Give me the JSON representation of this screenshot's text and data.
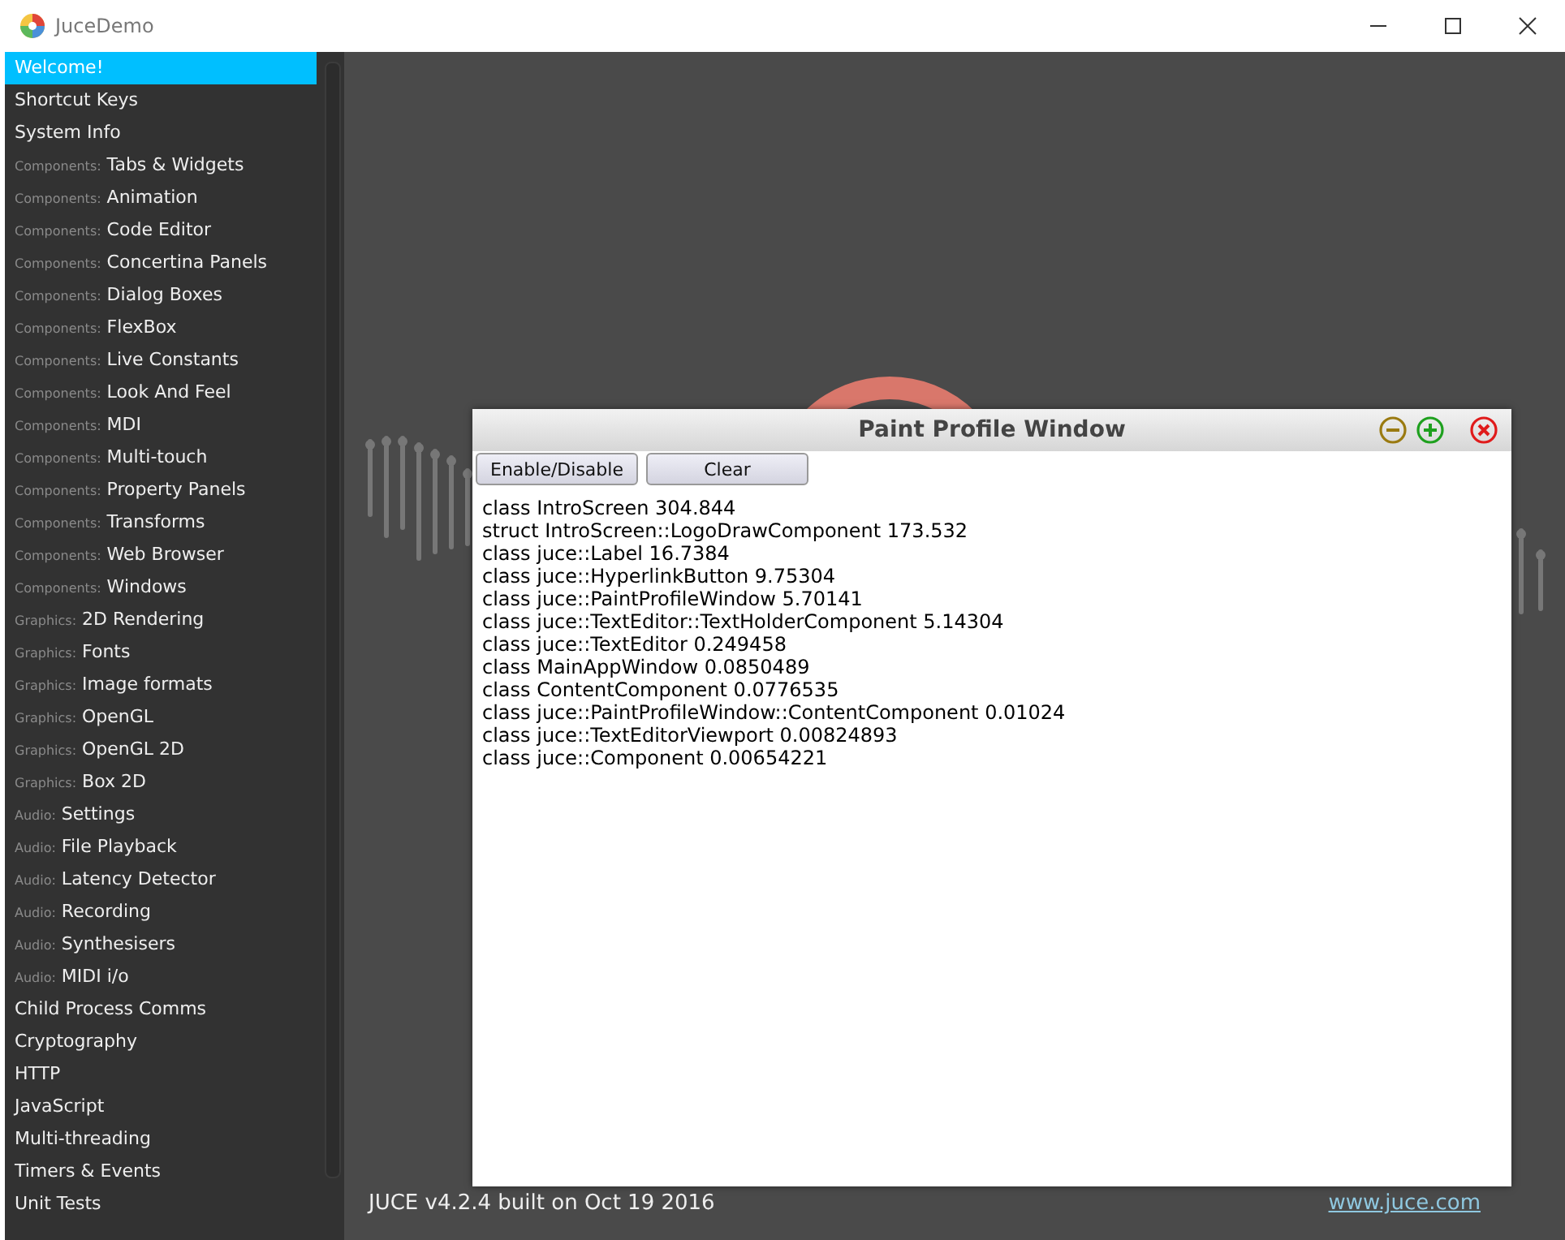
{
  "window": {
    "title": "JuceDemo"
  },
  "sidebar": {
    "items": [
      {
        "label": "Welcome!",
        "selected": true
      },
      {
        "label": "Shortcut Keys",
        "selected": false
      },
      {
        "label": "System Info",
        "selected": false
      },
      {
        "category": "Components:",
        "label": "Tabs & Widgets",
        "selected": false
      },
      {
        "category": "Components:",
        "label": "Animation",
        "selected": false
      },
      {
        "category": "Components:",
        "label": "Code Editor",
        "selected": false
      },
      {
        "category": "Components:",
        "label": "Concertina Panels",
        "selected": false
      },
      {
        "category": "Components:",
        "label": "Dialog Boxes",
        "selected": false
      },
      {
        "category": "Components:",
        "label": "FlexBox",
        "selected": false
      },
      {
        "category": "Components:",
        "label": "Live Constants",
        "selected": false
      },
      {
        "category": "Components:",
        "label": "Look And Feel",
        "selected": false
      },
      {
        "category": "Components:",
        "label": "MDI",
        "selected": false
      },
      {
        "category": "Components:",
        "label": "Multi-touch",
        "selected": false
      },
      {
        "category": "Components:",
        "label": "Property Panels",
        "selected": false
      },
      {
        "category": "Components:",
        "label": "Transforms",
        "selected": false
      },
      {
        "category": "Components:",
        "label": "Web Browser",
        "selected": false
      },
      {
        "category": "Components:",
        "label": "Windows",
        "selected": false
      },
      {
        "category": "Graphics:",
        "label": "2D Rendering",
        "selected": false
      },
      {
        "category": "Graphics:",
        "label": "Fonts",
        "selected": false
      },
      {
        "category": "Graphics:",
        "label": "Image formats",
        "selected": false
      },
      {
        "category": "Graphics:",
        "label": "OpenGL",
        "selected": false
      },
      {
        "category": "Graphics:",
        "label": "OpenGL 2D",
        "selected": false
      },
      {
        "category": "Graphics:",
        "label": "Box 2D",
        "selected": false
      },
      {
        "category": "Audio:",
        "label": "Settings",
        "selected": false
      },
      {
        "category": "Audio:",
        "label": "File Playback",
        "selected": false
      },
      {
        "category": "Audio:",
        "label": "Latency Detector",
        "selected": false
      },
      {
        "category": "Audio:",
        "label": "Recording",
        "selected": false
      },
      {
        "category": "Audio:",
        "label": "Synthesisers",
        "selected": false
      },
      {
        "category": "Audio:",
        "label": "MIDI i/o",
        "selected": false
      },
      {
        "label": "Child Process Comms",
        "selected": false
      },
      {
        "label": "Cryptography",
        "selected": false
      },
      {
        "label": "HTTP",
        "selected": false
      },
      {
        "label": "JavaScript",
        "selected": false
      },
      {
        "label": "Multi-threading",
        "selected": false
      },
      {
        "label": "Timers & Events",
        "selected": false
      },
      {
        "label": "Unit Tests",
        "selected": false
      }
    ]
  },
  "dialog": {
    "title": "Paint Profile Window",
    "buttons": [
      "Enable/Disable",
      "Clear"
    ],
    "lines": [
      "class IntroScreen 304.844",
      "struct IntroScreen::LogoDrawComponent 173.532",
      "class juce::Label 16.7384",
      "class juce::HyperlinkButton 9.75304",
      "class juce::PaintProfileWindow 5.70141",
      "class juce::TextEditor::TextHolderComponent 5.14304",
      "class juce::TextEditor 0.249458",
      "class MainAppWindow 0.0850489",
      "class ContentComponent 0.0776535",
      "class juce::PaintProfileWindow::ContentComponent 0.01024",
      "class juce::TextEditorViewport 0.00824893",
      "class juce::Component 0.00654221"
    ]
  },
  "footer": {
    "version": "JUCE v4.2.4  built on Oct 19 2016",
    "link": "www.juce.com"
  }
}
